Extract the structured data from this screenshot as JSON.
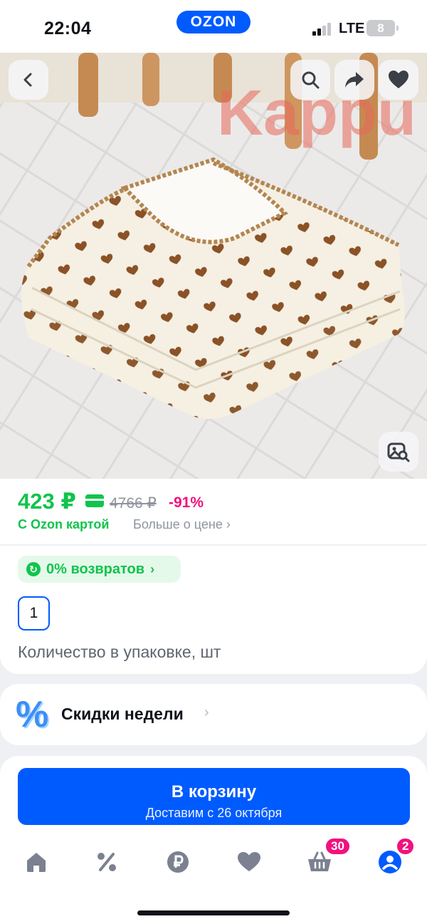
{
  "status_bar": {
    "time": "22:04",
    "brand": "OZON",
    "network": "LTE",
    "battery": "8"
  },
  "product_image": {
    "watermark": "Kappu",
    "buttons": {
      "back": "back-icon",
      "search": "search-icon",
      "share": "share-icon",
      "favorite": "heart-icon",
      "visual_search": "image-search-icon"
    }
  },
  "price": {
    "current": "423 ₽",
    "old": "4766 ₽",
    "discount": "-91%",
    "card_label": "С Ozon картой",
    "more_label": "Больше о цене",
    "more_chevron": "›",
    "accent_green": "#10c44c",
    "discount_pink": "#f1117e"
  },
  "info": {
    "returns_label": "0% возвратов",
    "returns_icon": "↻",
    "returns_chevron": "›",
    "quantity_option": "1",
    "quantity_label": "Количество в упаковке, шт"
  },
  "promo": {
    "icon": "%",
    "label": "Скидки недели",
    "chevron": "›"
  },
  "cart_button": {
    "title": "В корзину",
    "subtitle": "Доставим с 26 октября",
    "color": "#005bff"
  },
  "tab_bar": {
    "items": [
      {
        "icon": "home-icon"
      },
      {
        "icon": "percent-icon"
      },
      {
        "icon": "ruble-icon"
      },
      {
        "icon": "heart-icon"
      },
      {
        "icon": "basket-icon",
        "badge": "30"
      },
      {
        "icon": "profile-icon",
        "badge": "2"
      }
    ]
  }
}
